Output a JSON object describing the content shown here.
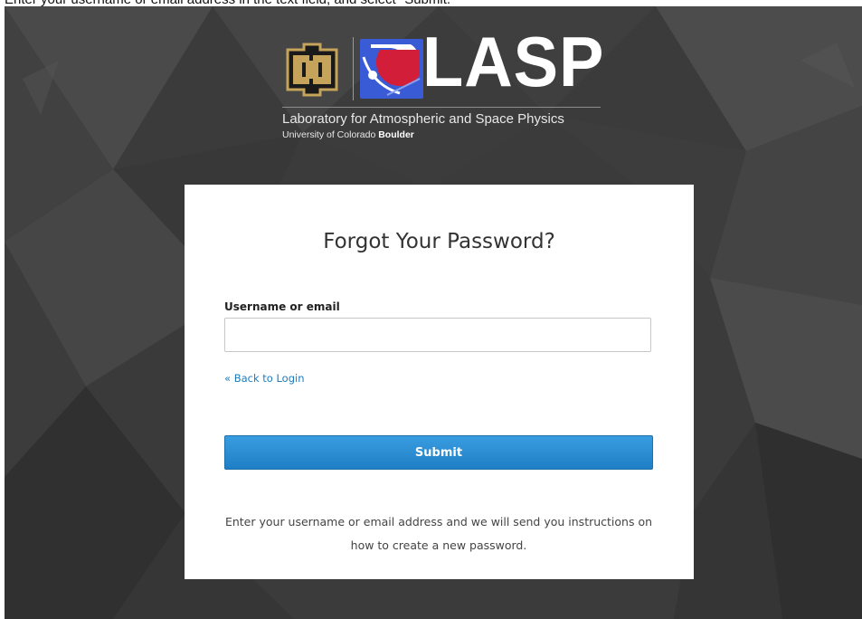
{
  "page": {
    "instruction": "Enter your username or email address in the text field, and select \"Submit.\""
  },
  "logo": {
    "cu_monogram": "CU",
    "wordmark": "LASP",
    "lab_name": "Laboratory for Atmospheric and Space Physics",
    "univ_prefix": "University of Colorado",
    "univ_bold": "Boulder"
  },
  "form": {
    "title": "Forgot Your Password?",
    "username_label": "Username or email",
    "username_value": "",
    "username_placeholder": "",
    "back_link": "« Back to Login",
    "submit_label": "Submit",
    "help_text": "Enter your username or email address and we will send you instructions on how to create a new password."
  },
  "colors": {
    "background": "#3a3a3a",
    "card": "#ffffff",
    "link": "#1a7dc0",
    "button": "#2a8ad4",
    "cu_gold": "#c5a35a",
    "lasp_blue": "#3a5bd6",
    "lasp_red": "#d31e3a"
  }
}
